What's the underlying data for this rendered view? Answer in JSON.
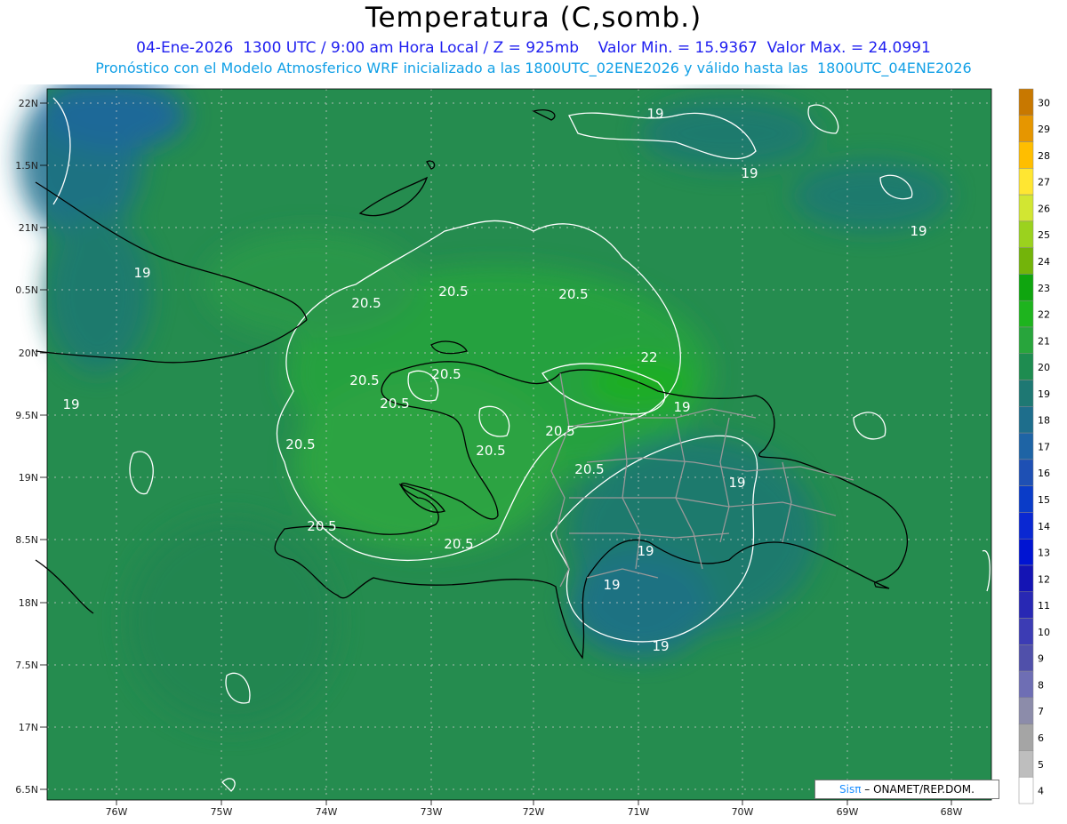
{
  "header": {
    "title": "Temperatura (C,somb.)",
    "line1": "04-Ene-2026  1300 UTC / 9:00 am Hora Local / Z = 925mb    Valor Min. = 15.9367  Valor Max. = 24.0991",
    "line2": "Pronóstico con el Modelo Atmosferico WRF inicializado a las 1800UTC_02ENE2026 y válido hasta las  1800UTC_04ENE2026"
  },
  "axes": {
    "x_ticks": [
      "76W",
      "75W",
      "74W",
      "73W",
      "72W",
      "71W",
      "70W",
      "69W",
      "68W"
    ],
    "y_ticks": [
      "22N",
      "1.5N",
      "21N",
      "0.5N",
      "20N",
      "9.5N",
      "19N",
      "8.5N",
      "18N",
      "7.5N",
      "17N",
      "6.5N"
    ]
  },
  "colorbar": {
    "levels": [
      "30",
      "29",
      "28",
      "27",
      "26",
      "25",
      "24",
      "23",
      "22",
      "21",
      "20",
      "19",
      "18",
      "17",
      "16",
      "15",
      "14",
      "13",
      "12",
      "11",
      "10",
      "9",
      "8",
      "7",
      "6",
      "5",
      "4"
    ],
    "colors": [
      "#c87800",
      "#e69600",
      "#ffbe00",
      "#ffe632",
      "#d2e632",
      "#9bd21e",
      "#73b40a",
      "#0fa50f",
      "#1eb41e",
      "#28a53c",
      "#1e8c50",
      "#1e7873",
      "#1e6e8c",
      "#1e64a5",
      "#1e50b4",
      "#0a3cc8",
      "#0a28d2",
      "#0014d2",
      "#1414b4",
      "#2828b4",
      "#3c3cb4",
      "#5050aa",
      "#6e6eb4",
      "#8c8caa",
      "#a5a5a5",
      "#bebebe",
      "#ffffff"
    ]
  },
  "contour_labels": [
    "19",
    "19",
    "19",
    "19",
    "19",
    "19",
    "19",
    "19",
    "19",
    "19",
    "20.5",
    "20.5",
    "20.5",
    "20.5",
    "20.5",
    "20.5",
    "20.5",
    "20.5",
    "20.5",
    "20.5",
    "20.5",
    "20.5",
    "22"
  ],
  "credit": {
    "brand": "Sisπ",
    "text": "– ONAMET/REP.DOM."
  }
}
